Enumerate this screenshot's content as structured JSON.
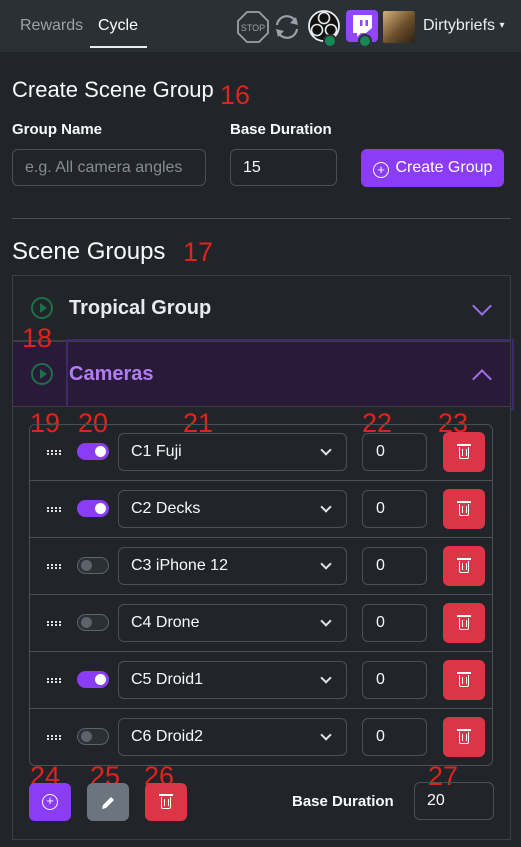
{
  "nav": {
    "tabs": [
      {
        "label": "Rewards",
        "active": false
      },
      {
        "label": "Cycle",
        "active": true
      }
    ],
    "stop_icon_text": "STOP",
    "obs_status_color": "#198754",
    "twitch_status_color": "#198754",
    "user_name": "Dirtybriefs"
  },
  "annotations": [
    "16",
    "17",
    "18",
    "19",
    "20",
    "21",
    "22",
    "23",
    "24",
    "25",
    "26",
    "27"
  ],
  "create_group": {
    "title": "Create Scene Group",
    "group_name_label": "Group Name",
    "group_name_placeholder": "e.g. All camera angles",
    "base_duration_label": "Base Duration",
    "base_duration_value": "15",
    "create_button_label": "Create Group"
  },
  "scene_groups": {
    "title": "Scene Groups",
    "groups": [
      {
        "name": "Tropical Group",
        "expanded": false
      },
      {
        "name": "Cameras",
        "expanded": true
      }
    ],
    "cameras": {
      "scenes": [
        {
          "name": "C1 Fuji",
          "enabled": true,
          "offset": "0"
        },
        {
          "name": "C2 Decks",
          "enabled": true,
          "offset": "0"
        },
        {
          "name": "C3 iPhone 12",
          "enabled": false,
          "offset": "0"
        },
        {
          "name": "C4 Drone",
          "enabled": false,
          "offset": "0"
        },
        {
          "name": "C5 Droid1",
          "enabled": true,
          "offset": "0"
        },
        {
          "name": "C6 Droid2",
          "enabled": false,
          "offset": "0"
        }
      ],
      "base_duration_label": "Base Duration",
      "base_duration_value": "20"
    }
  },
  "colors": {
    "accent": "#8b3df5",
    "danger": "#dc3545",
    "secondary": "#6c757d",
    "play_icon": "#1e6f47",
    "annotation": "#e0231d"
  }
}
